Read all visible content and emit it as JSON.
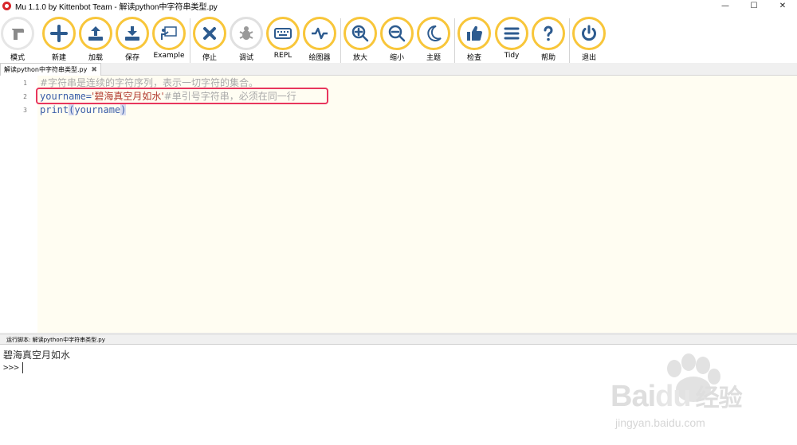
{
  "window": {
    "title": "Mu 1.1.0 by Kittenbot Team - 解读python中字符串类型.py",
    "controls": [
      "—",
      "☐",
      "✕"
    ]
  },
  "toolbar": {
    "buttons": [
      {
        "id": "mode",
        "label": "模式",
        "icon": "mode-icon"
      },
      {
        "id": "new",
        "label": "新建",
        "icon": "plus-icon"
      },
      {
        "id": "load",
        "label": "加载",
        "icon": "upload-icon"
      },
      {
        "id": "save",
        "label": "保存",
        "icon": "download-icon"
      },
      {
        "id": "example",
        "label": "Example",
        "icon": "teacher-icon"
      },
      {
        "id": "stop",
        "label": "停止",
        "icon": "close-icon"
      },
      {
        "id": "debug",
        "label": "调试",
        "icon": "bug-icon"
      },
      {
        "id": "repl",
        "label": "REPL",
        "icon": "keyboard-icon"
      },
      {
        "id": "plotter",
        "label": "绘图器",
        "icon": "pulse-icon"
      },
      {
        "id": "zoomin",
        "label": "放大",
        "icon": "zoom-in-icon"
      },
      {
        "id": "zoomout",
        "label": "缩小",
        "icon": "zoom-out-icon"
      },
      {
        "id": "theme",
        "label": "主题",
        "icon": "moon-icon"
      },
      {
        "id": "check",
        "label": "检查",
        "icon": "thumbs-up-icon"
      },
      {
        "id": "tidy",
        "label": "Tidy",
        "icon": "menu-icon"
      },
      {
        "id": "help",
        "label": "帮助",
        "icon": "question-icon"
      },
      {
        "id": "quit",
        "label": "退出",
        "icon": "power-icon"
      }
    ],
    "colors": {
      "ring": "#f8c63a",
      "icon": "#2d5b8f"
    }
  },
  "tabs": [
    {
      "label": "解读python中字符串类型.py",
      "close": "✖"
    }
  ],
  "editor": {
    "lines": [
      {
        "num": "1",
        "comment": "#字符串是连续的字符序列，表示一切字符的集合。"
      },
      {
        "num": "2",
        "ident": "yourname=",
        "string": "'碧海真空月如水'",
        "comment": "#单引号字符串，必须在同一行"
      },
      {
        "num": "3",
        "keyword": "print",
        "paren_open": "(",
        "arg": "yourname",
        "paren_close": ")"
      }
    ]
  },
  "repl": {
    "header": "运行脚本: 解读python中字符串类型.py",
    "output": "碧海真空月如水",
    "prompt": ">>>"
  },
  "watermark": {
    "brand": "Bai",
    "brand2": "du",
    "cn": "经验",
    "url": "jingyan.baidu.com"
  }
}
